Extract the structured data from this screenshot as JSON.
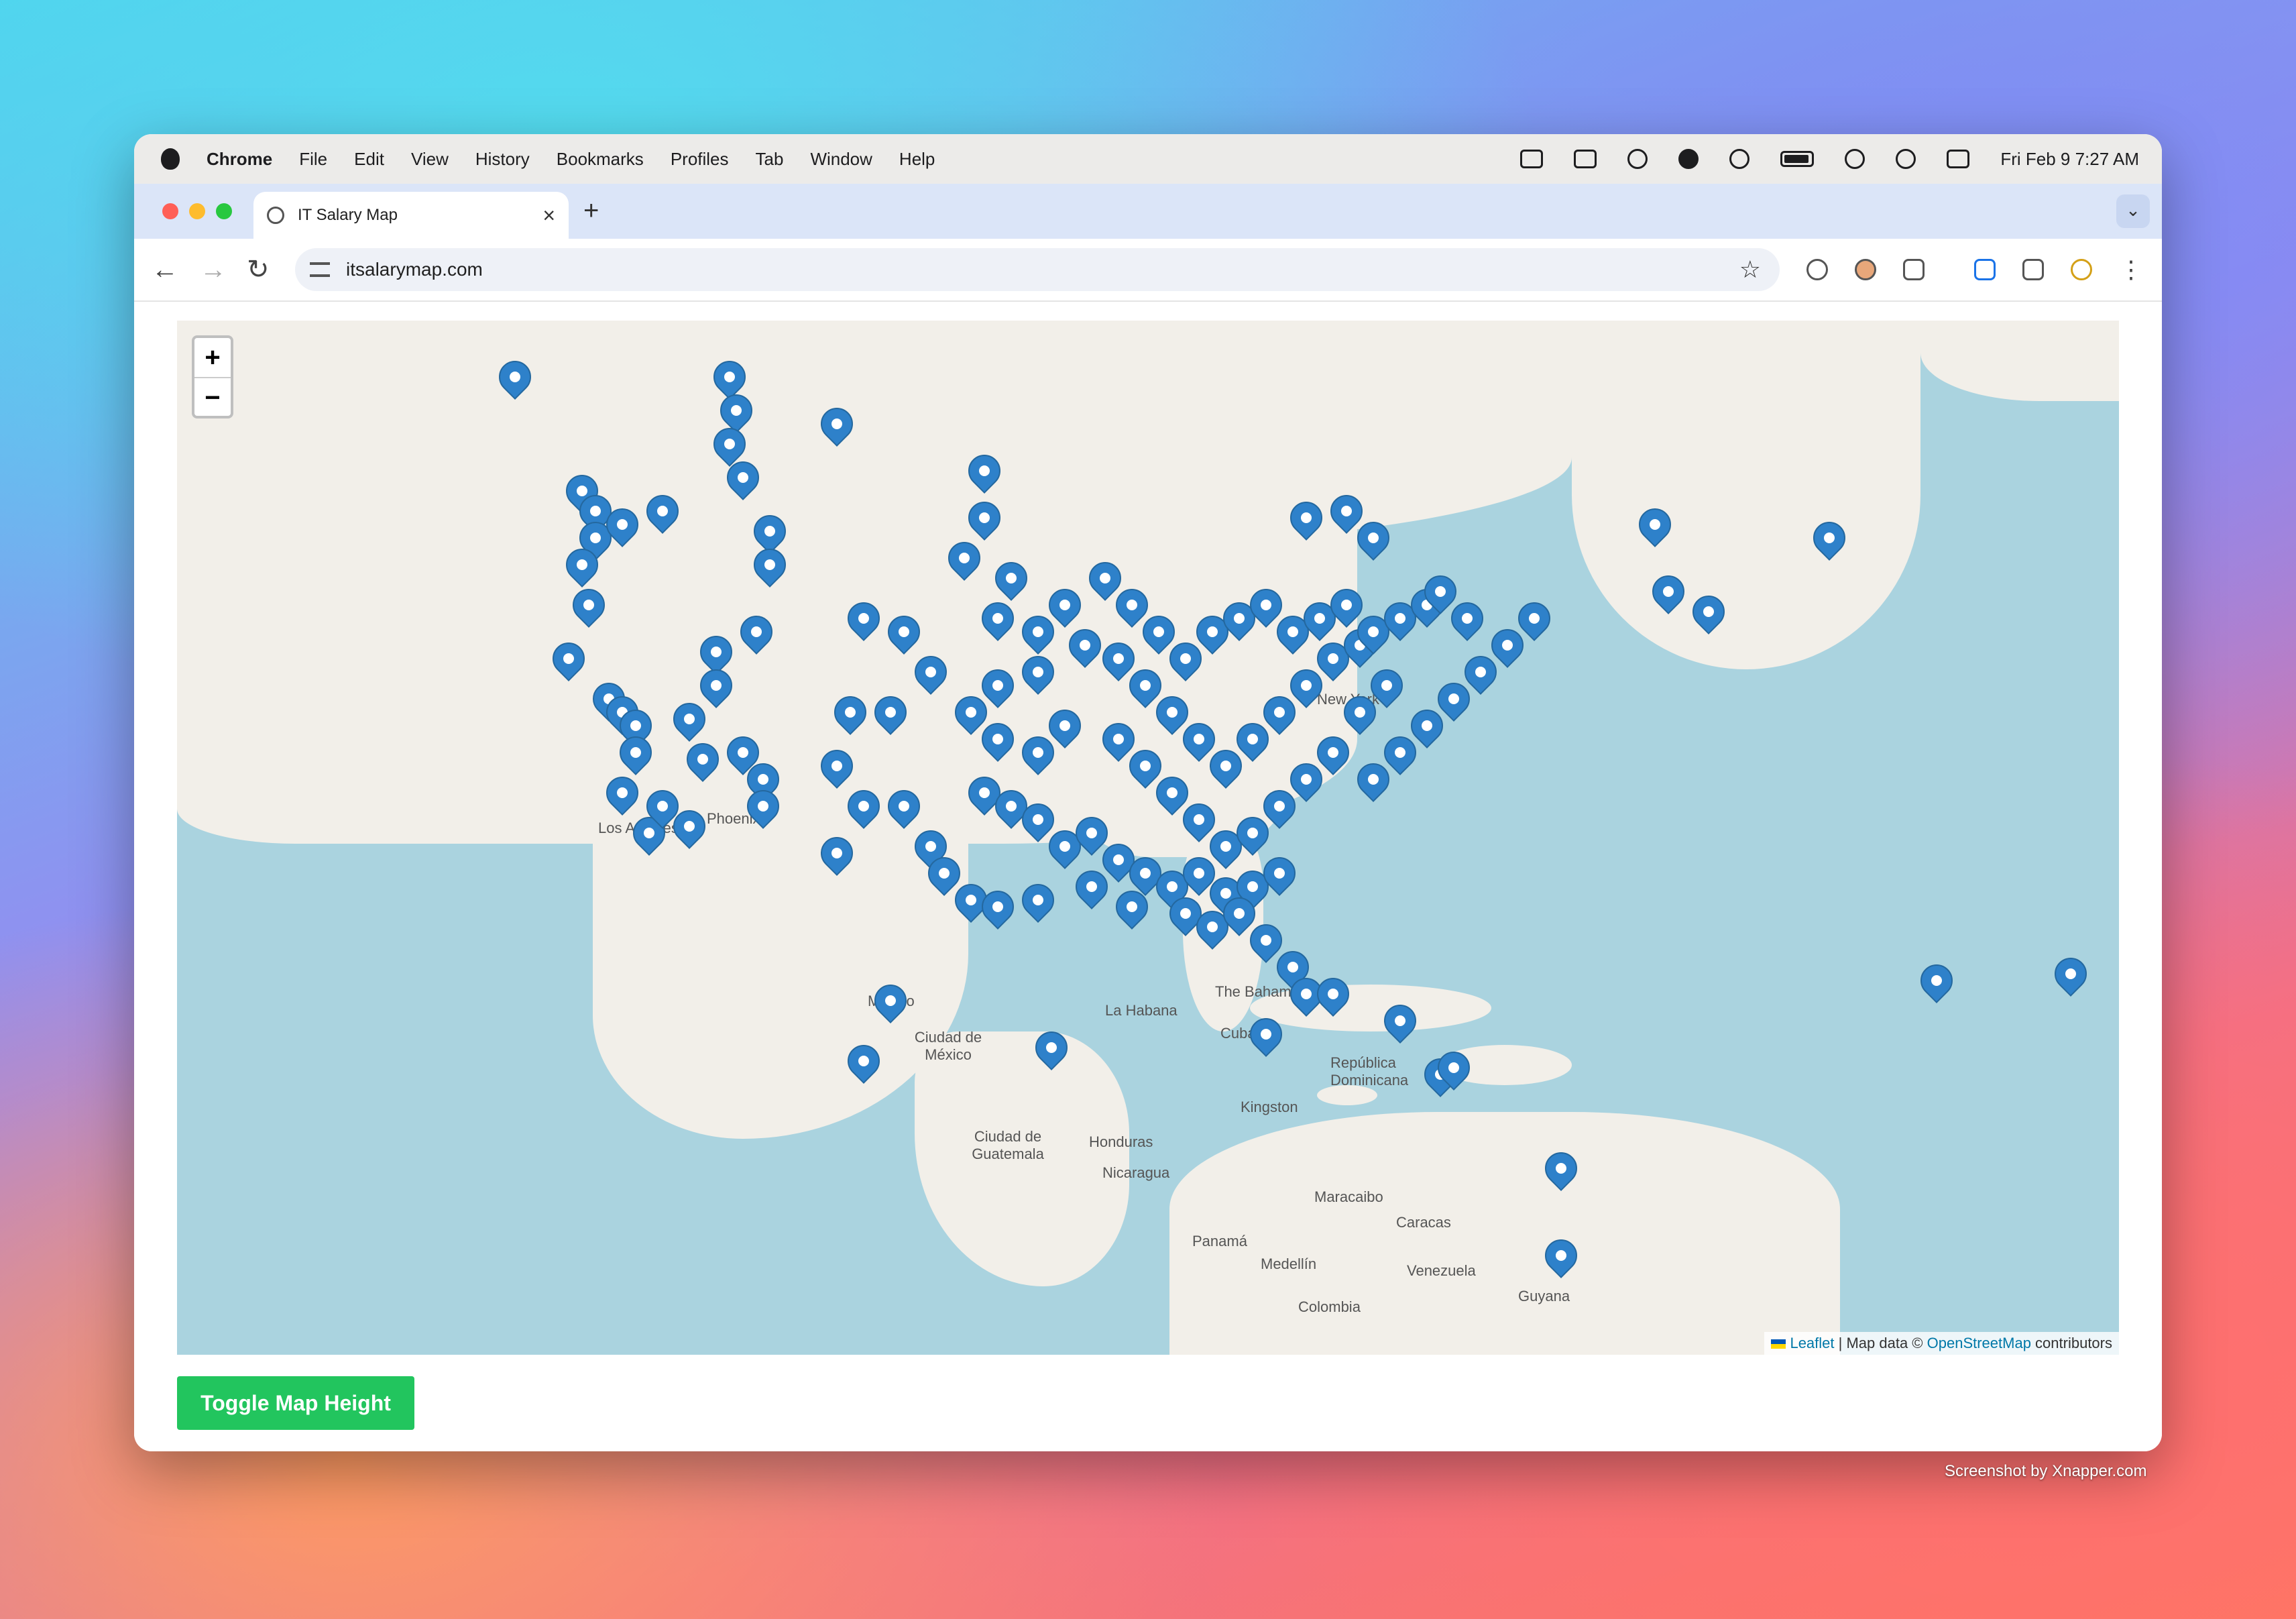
{
  "menubar": {
    "app_name": "Chrome",
    "items": [
      "File",
      "Edit",
      "View",
      "History",
      "Bookmarks",
      "Profiles",
      "Tab",
      "Window",
      "Help"
    ],
    "clock": "Fri Feb 9  7:27 AM"
  },
  "tab": {
    "title": "IT Salary Map",
    "close": "×",
    "new_tab": "+"
  },
  "toolbar": {
    "url": "itsalarymap.com"
  },
  "map": {
    "zoom_in": "+",
    "zoom_out": "−",
    "attribution": {
      "leaflet": "Leaflet",
      "middle": " | Map data © ",
      "osm": "OpenStreetMap",
      "end": " contributors"
    },
    "labels": [
      "Los Angeles",
      "Phoenix",
      "New York",
      "México",
      "Ciudad de México",
      "La Habana",
      "The Bahamas",
      "Cuba",
      "República Dominicana",
      "Kingston",
      "Ciudad de Guatemala",
      "Honduras",
      "Nicaragua",
      "Maracaibo",
      "Caracas",
      "Panamá",
      "Medellín",
      "Venezuela",
      "Colombia",
      "Guyana"
    ]
  },
  "button": {
    "toggle_label": "Toggle Map Height"
  },
  "credit": "Screenshot by Xnapper.com"
}
